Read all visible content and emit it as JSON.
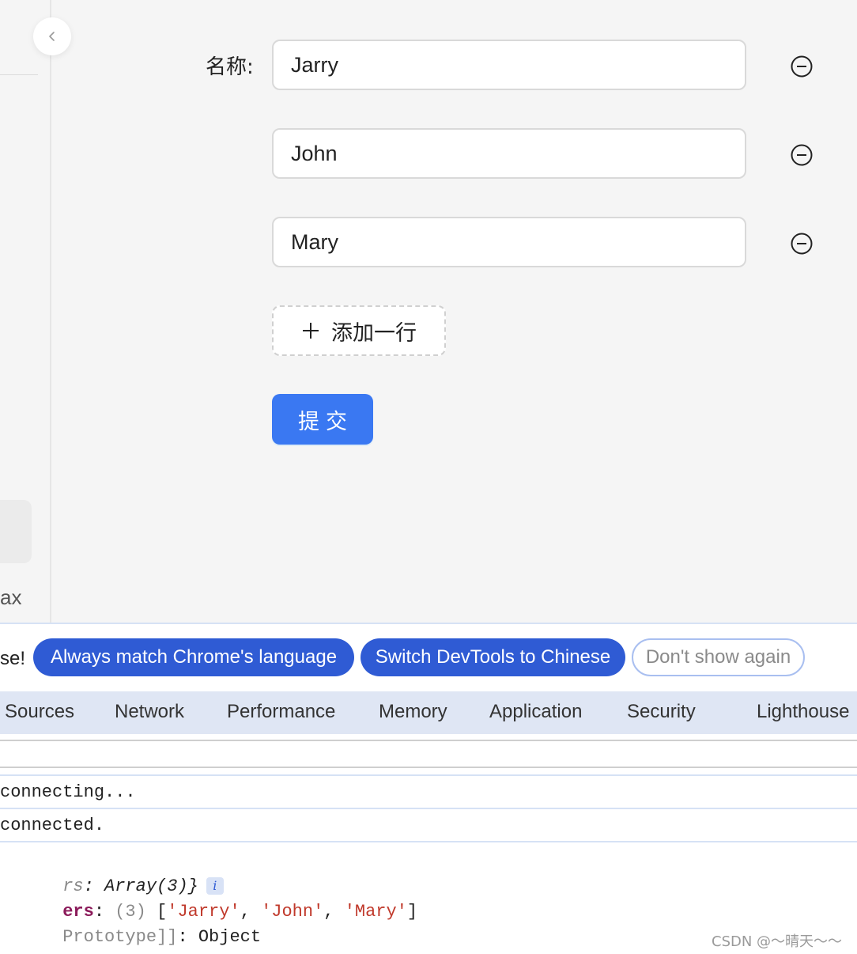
{
  "sidebar": {
    "truncated_text": "ax"
  },
  "form": {
    "label": "名称:",
    "inputs": [
      "Jarry",
      "John",
      "Mary"
    ],
    "add_row_label": "添加一行",
    "submit_label": "提交"
  },
  "devtools": {
    "language_prompt_truncated": "se!",
    "always_match_label": "Always match Chrome's language",
    "switch_label": "Switch DevTools to Chinese",
    "dont_show_label": "Don't show again",
    "tabs": [
      "Sources",
      "Network",
      "Performance",
      "Memory",
      "Application",
      "Security",
      "Lighthouse"
    ],
    "console": {
      "line1": "connecting...",
      "line2": "connected.",
      "obj_summary_key": "rs",
      "obj_summary_value": ": Array(3)}",
      "obj_info_badge": "i",
      "obj_key": "ers",
      "obj_count": "(3)",
      "obj_values": [
        "Jarry",
        "John",
        "Mary"
      ],
      "proto_label": "Prototype]]",
      "proto_value": ": Object"
    }
  },
  "watermark": "CSDN @～晴天～～",
  "colors": {
    "primary": "#3a78f2",
    "devtools_pill": "#2f5bd4",
    "tabs_bg": "#dfe6f4",
    "string": "#c0392b",
    "key": "#8b1a5a"
  }
}
